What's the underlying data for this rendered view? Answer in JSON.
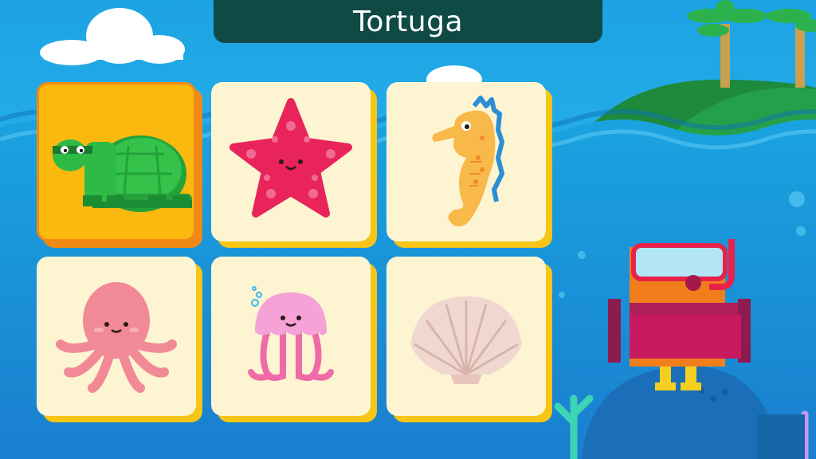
{
  "game": {
    "word": "Tortuga",
    "cards": [
      {
        "id": "turtle",
        "icon": "turtle-icon",
        "selected": true
      },
      {
        "id": "starfish",
        "icon": "starfish-icon",
        "selected": false
      },
      {
        "id": "seahorse",
        "icon": "seahorse-icon",
        "selected": false
      },
      {
        "id": "octopus",
        "icon": "octopus-icon",
        "selected": false
      },
      {
        "id": "jellyfish",
        "icon": "jellyfish-icon",
        "selected": false
      },
      {
        "id": "seashell",
        "icon": "seashell-icon",
        "selected": false
      }
    ]
  },
  "colors": {
    "sky": "#22a7e6",
    "sea": "#1a8fd6",
    "title_bar": "#0f4a45",
    "card_face": "#fdf4d2",
    "card_shadow": "#f6c515",
    "selected_face": "#fbb80f"
  }
}
